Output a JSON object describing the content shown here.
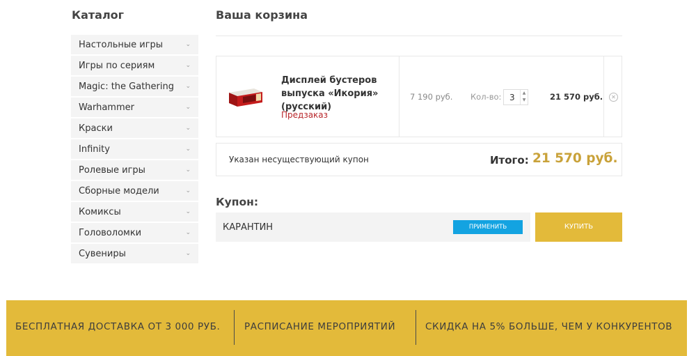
{
  "catalog": {
    "title": "Каталог",
    "items": [
      {
        "label": "Настольные игры"
      },
      {
        "label": "Игры по сериям"
      },
      {
        "label": "Magic: the Gathering"
      },
      {
        "label": "Warhammer"
      },
      {
        "label": "Краски"
      },
      {
        "label": "Infinity"
      },
      {
        "label": "Ролевые игры"
      },
      {
        "label": "Сборные модели"
      },
      {
        "label": "Комиксы"
      },
      {
        "label": "Головоломки"
      },
      {
        "label": "Сувениры"
      }
    ]
  },
  "cart": {
    "title": "Ваша корзина",
    "item": {
      "name": "Дисплей бустеров выпуска «Икория» (русский)",
      "status": "Предзаказ",
      "unit_price": "7 190 руб.",
      "qty_label": "Кол-во:",
      "qty": "3",
      "total": "21 570 руб."
    },
    "coupon_message": "Указан несуществующий купон",
    "total_label": "Итого:",
    "total_value": "21 570 руб."
  },
  "coupon": {
    "title": "Купон:",
    "value": "КАРАНТИН",
    "apply_label": "ПРИМЕНИТЬ",
    "buy_label": "КУПИТЬ"
  },
  "promo": {
    "items": [
      {
        "label": "БЕСПЛАТНАЯ ДОСТАВКА ОТ 3 000 РУБ."
      },
      {
        "label": "РАСПИСАНИЕ МЕРОПРИЯТИЙ"
      },
      {
        "label": "СКИДКА НА 5% БОЛЬШЕ, ЧЕМ У КОНКУРЕНТОВ"
      }
    ]
  },
  "colors": {
    "accent": "#e3ba3a",
    "total": "#c9a23a",
    "preorder": "#b8262a",
    "apply_button": "#13a3e1"
  }
}
